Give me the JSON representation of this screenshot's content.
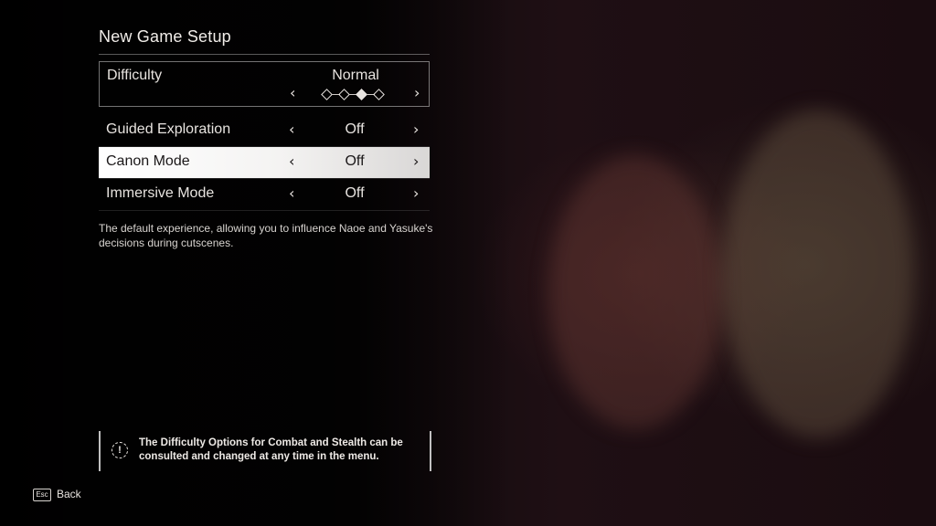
{
  "screen": {
    "title": "New Game Setup"
  },
  "difficulty": {
    "label": "Difficulty",
    "value": "Normal",
    "levels_total": 4,
    "selected_level": 3,
    "prev_glyph": "‹",
    "next_glyph": "›"
  },
  "options": [
    {
      "label": "Guided Exploration",
      "value": "Off",
      "prev_glyph": "‹",
      "next_glyph": "›"
    },
    {
      "label": "Canon Mode",
      "value": "Off",
      "prev_glyph": "‹",
      "next_glyph": "›"
    },
    {
      "label": "Immersive Mode",
      "value": "Off",
      "prev_glyph": "‹",
      "next_glyph": "›"
    }
  ],
  "description": "The default experience, allowing you to influence Naoe and Yasuke's decisions during cutscenes.",
  "notice": {
    "icon": "alert-icon",
    "icon_glyph": "!",
    "text": "The Difficulty Options for Combat and Stealth can be consulted and changed at any time in the menu."
  },
  "footer": {
    "back_key": "Esc",
    "back_label": "Back"
  },
  "colors": {
    "selected_row_bg": "#ffffff",
    "text": "#e8e4e0",
    "background": "#0b0709"
  }
}
